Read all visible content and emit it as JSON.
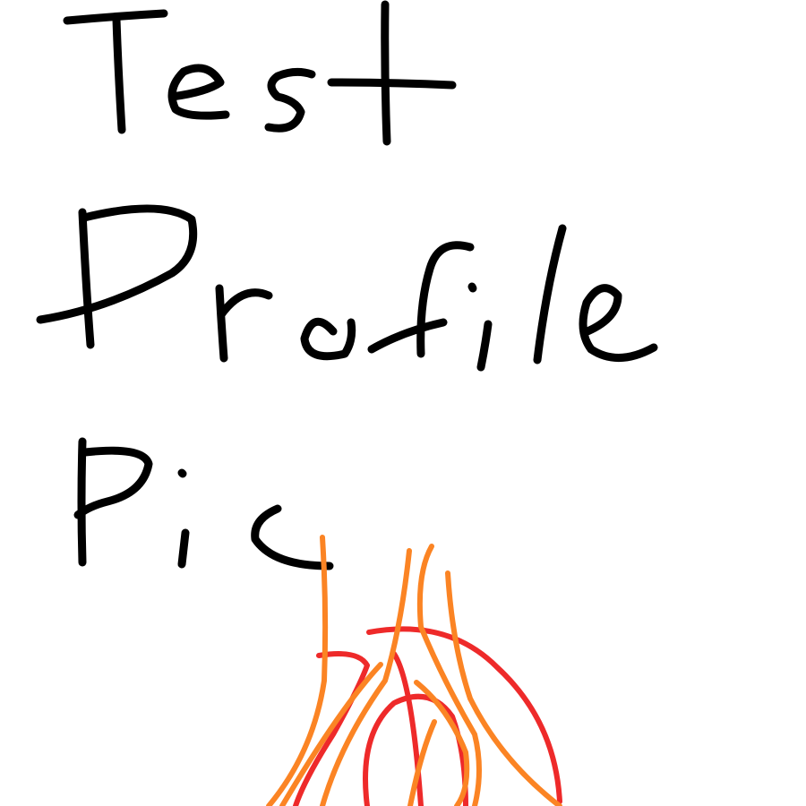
{
  "handwritten_text": {
    "line1": "Test",
    "line2": "Profile",
    "line3": "Pic"
  },
  "colors": {
    "background": "#ffffff",
    "ink": "#000000",
    "flame_red": "#ee2a2a",
    "flame_orange": "#fb8424"
  },
  "icons": {
    "flame": "flame-icon"
  }
}
